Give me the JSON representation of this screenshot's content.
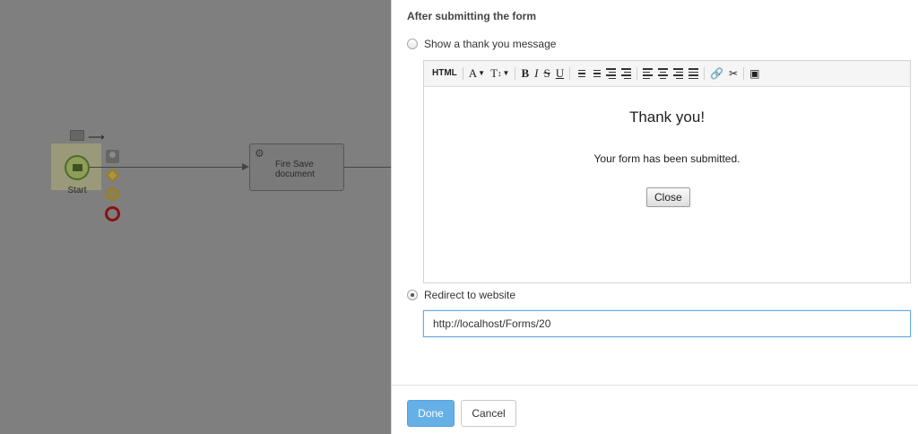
{
  "canvas": {
    "start_label": "Start",
    "task_label": "Fire Save document",
    "colors": {
      "background": "#7f7f7f",
      "start_highlight": "#9a9a7a",
      "end_event": "#8a1212",
      "gateway": "#9c7e1d"
    }
  },
  "panel": {
    "section_title": "After submitting the form",
    "options": {
      "thank_you": {
        "label": "Show a thank you message",
        "selected": false
      },
      "redirect": {
        "label": "Redirect to website",
        "selected": true
      }
    },
    "editor": {
      "toolbar": {
        "html": "HTML",
        "font": "A",
        "size": "T",
        "bold": "B",
        "italic": "I",
        "strike": "S",
        "underline": "U",
        "icons": [
          "unordered-list-icon",
          "ordered-list-icon",
          "outdent-icon",
          "indent-icon",
          "align-left-icon",
          "align-center-icon",
          "align-right-icon",
          "justify-icon",
          "link-icon",
          "unlink-icon",
          "image-icon"
        ]
      },
      "content": {
        "heading": "Thank you!",
        "message": "Your form has been submitted.",
        "close_button": "Close"
      }
    },
    "redirect_url": "http://localhost/Forms/20",
    "footer": {
      "done": "Done",
      "cancel": "Cancel"
    },
    "colors": {
      "done_button": "#65b0e6",
      "input_focus_border": "#6aa9df"
    }
  }
}
